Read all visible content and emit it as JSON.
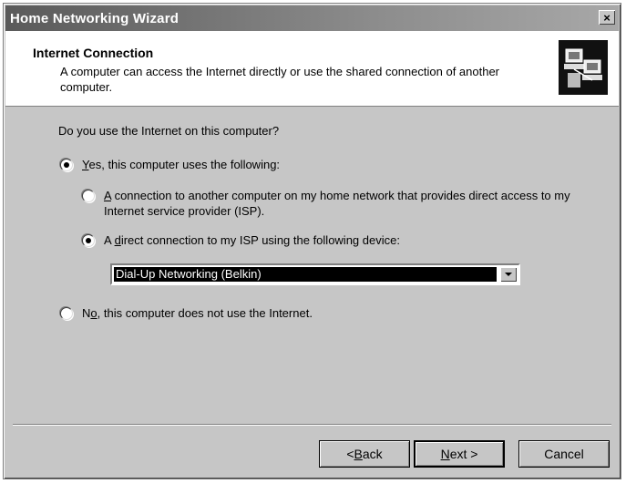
{
  "window": {
    "title": "Home Networking Wizard",
    "close_glyph": "×"
  },
  "header": {
    "title": "Internet Connection",
    "description": "A computer can access the Internet directly or use the shared connection of another computer."
  },
  "question": "Do you use the Internet on this computer?",
  "options": {
    "yes": {
      "accel": "Y",
      "rest": "es, this computer uses the following:",
      "checked": true
    },
    "connection": {
      "accel": "A",
      "rest": " connection to another computer on my home network that provides direct access to my Internet service provider (ISP).",
      "checked": false
    },
    "direct": {
      "pre": "A ",
      "accel": "d",
      "rest": "irect connection to my ISP using the following device:",
      "checked": true
    },
    "no": {
      "pre": "N",
      "accel": "o",
      "rest": ", this computer does not use the Internet.",
      "checked": false
    }
  },
  "device_select": {
    "value": "Dial-Up Networking (Belkin)"
  },
  "buttons": {
    "back": {
      "pre": "< ",
      "accel": "B",
      "rest": "ack"
    },
    "next": {
      "accel": "N",
      "rest": "ext >"
    },
    "cancel": "Cancel"
  },
  "icons": {
    "wizard": "network-computers-icon",
    "close": "close-icon",
    "dropdown": "chevron-down-icon"
  }
}
